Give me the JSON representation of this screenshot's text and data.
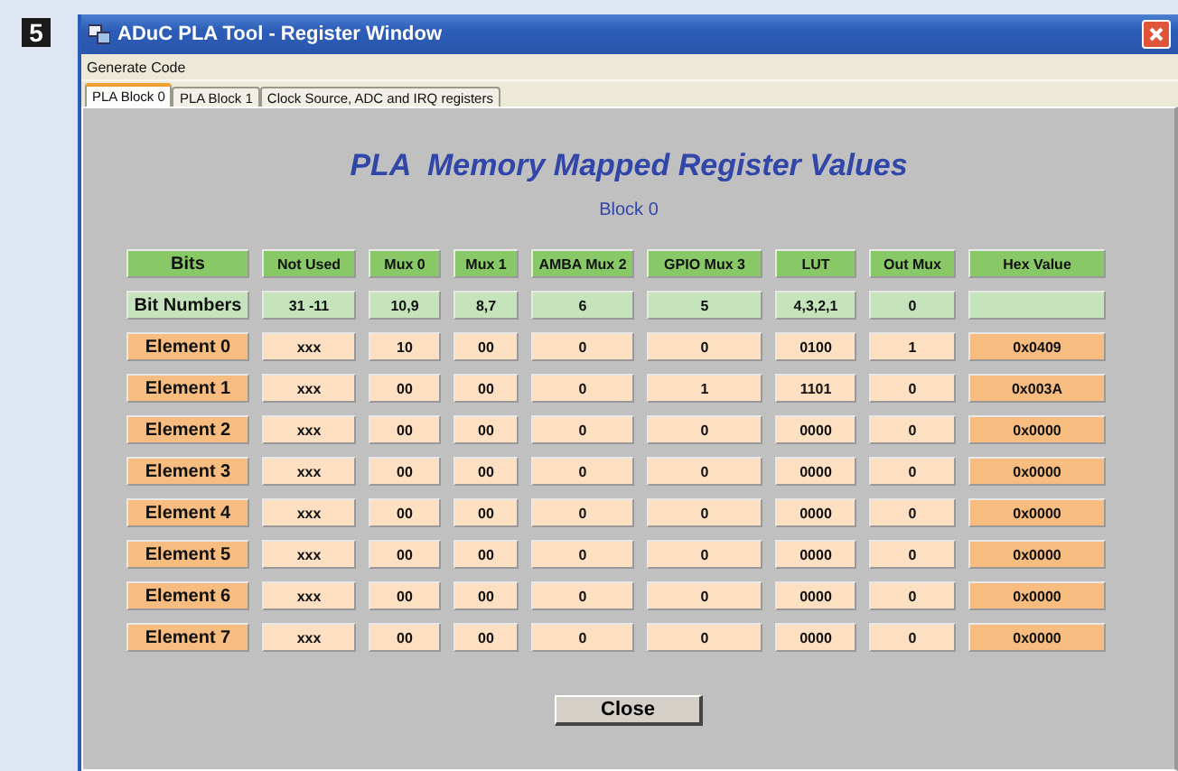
{
  "figure_number": "5",
  "window": {
    "title": "ADuC PLA Tool - Register Window"
  },
  "menu": [
    "Generate Code"
  ],
  "tabs": [
    {
      "label": "PLA Block 0",
      "selected": true
    },
    {
      "label": "PLA Block 1",
      "selected": false
    },
    {
      "label": "Clock Source, ADC and IRQ registers",
      "selected": false
    }
  ],
  "heading": "PLA  Memory Mapped Register Values",
  "subheading": "Block 0",
  "table": {
    "columns": [
      "Bits",
      "Not Used",
      "Mux 0",
      "Mux 1",
      "AMBA Mux 2",
      "GPIO Mux 3",
      "LUT",
      "Out Mux",
      "Hex Value"
    ],
    "bit_numbers": {
      "label": "Bit Numbers",
      "values": [
        "31 -11",
        "10,9",
        "8,7",
        "6",
        "5",
        "4,3,2,1",
        "0"
      ]
    },
    "elements": [
      {
        "label": "Element 0",
        "values": [
          "xxx",
          "10",
          "00",
          "0",
          "0",
          "0100",
          "1"
        ],
        "hex": "0x0409"
      },
      {
        "label": "Element 1",
        "values": [
          "xxx",
          "00",
          "00",
          "0",
          "1",
          "1101",
          "0"
        ],
        "hex": "0x003A"
      },
      {
        "label": "Element 2",
        "values": [
          "xxx",
          "00",
          "00",
          "0",
          "0",
          "0000",
          "0"
        ],
        "hex": "0x0000"
      },
      {
        "label": "Element 3",
        "values": [
          "xxx",
          "00",
          "00",
          "0",
          "0",
          "0000",
          "0"
        ],
        "hex": "0x0000"
      },
      {
        "label": "Element 4",
        "values": [
          "xxx",
          "00",
          "00",
          "0",
          "0",
          "0000",
          "0"
        ],
        "hex": "0x0000"
      },
      {
        "label": "Element 5",
        "values": [
          "xxx",
          "00",
          "00",
          "0",
          "0",
          "0000",
          "0"
        ],
        "hex": "0x0000"
      },
      {
        "label": "Element 6",
        "values": [
          "xxx",
          "00",
          "00",
          "0",
          "0",
          "0000",
          "0"
        ],
        "hex": "0x0000"
      },
      {
        "label": "Element 7",
        "values": [
          "xxx",
          "00",
          "00",
          "0",
          "0",
          "0000",
          "0"
        ],
        "hex": "0x0000"
      }
    ]
  },
  "buttons": [
    "Close"
  ]
}
